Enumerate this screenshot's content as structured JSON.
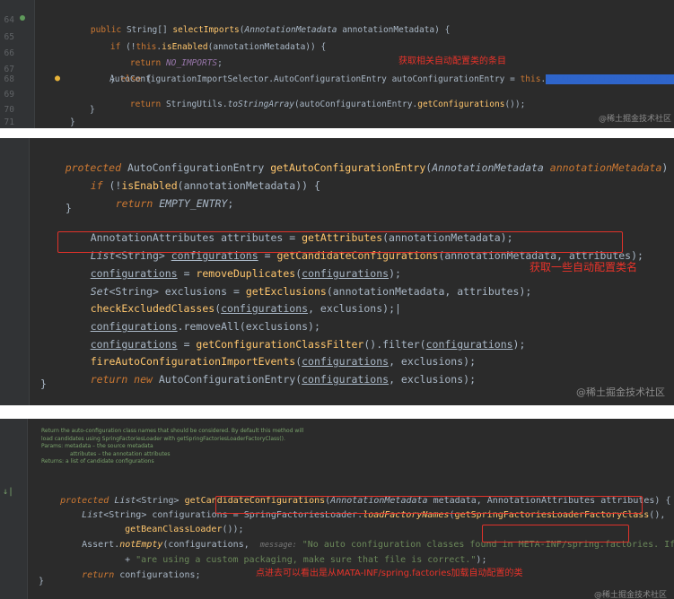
{
  "panel1": {
    "line_numbers": [
      "64",
      "65",
      "66",
      "67",
      "68",
      "69",
      "70",
      "71"
    ],
    "lines": [
      "public String[] selectImports(AnnotationMetadata annotationMetadata) {",
      "if (!this.isEnabled(annotationMetadata)) {",
      "return NO_IMPORTS;",
      "} else {",
      "AutoConfigurationImportSelector.AutoConfigurationEntry autoConfigurationEntry = this.",
      "return StringUtils.toStringArray(autoConfigurationEntry.getConfigurations());",
      "}",
      "}"
    ],
    "selected_call": "getAutoConfigurationEntry",
    "tail": "(a",
    "annotation": "获取相关自动配置类的条目",
    "watermark": "@稀土掘金技术社区"
  },
  "panel2": {
    "signature": {
      "modifier": "protected",
      "type": "AutoConfigurationEntry",
      "name": "getAutoConfigurationEntry",
      "param_type": "AnnotationMetadata",
      "param_name": "annotationMetadata"
    },
    "lines": [
      "if (!isEnabled(annotationMetadata)) {",
      "return EMPTY_ENTRY;",
      "}",
      "AnnotationAttributes attributes = getAttributes(annotationMetadata);",
      "List<String> configurations = getCandidateConfigurations(annotationMetadata, attributes);",
      "configurations = removeDuplicates(configurations);",
      "Set<String> exclusions = getExclusions(annotationMetadata, attributes);",
      "checkExcludedClasses(configurations, exclusions);",
      "configurations.removeAll(exclusions);",
      "configurations = getConfigurationClassFilter().filter(configurations);",
      "fireAutoConfigurationImportEvents(configurations, exclusions);",
      "return new AutoConfigurationEntry(configurations, exclusions);",
      "}"
    ],
    "annotation": "获取一些自动配置类名",
    "watermark": "@稀土掘金技术社区"
  },
  "panel3": {
    "doc": [
      "Return the auto-configuration class names that should be considered. By default this method will",
      "load candidates using SpringFactoriesLoader with getSpringFactoriesLoaderFactoryClass().",
      "Params: metadata – the source metadata",
      "attributes – the annotation attributes",
      "Returns: a list of candidate configurations"
    ],
    "lines": [
      "protected List<String> getCandidateConfigurations(AnnotationMetadata metadata, AnnotationAttributes attributes) {",
      "List<String> configurations = SpringFactoriesLoader.loadFactoryNames(getSpringFactoriesLoaderFactoryClass(),",
      "getBeanClassLoader());",
      "Assert.notEmpty(configurations,",
      "message:",
      "\"No auto configuration classes found in META-INF/spring.factories. If you",
      "+ \"are using a custom packaging, make sure that file is correct.\");",
      "return configurations;",
      "}"
    ],
    "annotation": "点进去可以看出是从MATA-INF/spring.factories加载自动配置的类",
    "watermark": "@稀土掘金技术社区"
  },
  "colors": {
    "keyword": "#cc7832",
    "method": "#ffc66d",
    "string": "#6a8759",
    "constant": "#9876aa",
    "annotation": "#e8332a",
    "box": "#e0322a",
    "selection": "#2f65ca"
  }
}
